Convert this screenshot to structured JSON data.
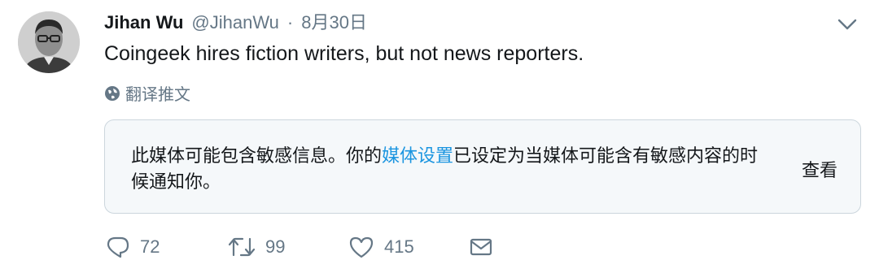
{
  "tweet": {
    "author_name": "Jihan Wu",
    "handle": "@JihanWu",
    "separator": "·",
    "date": "8月30日",
    "text": "Coingeek hires fiction writers, but not news reporters.",
    "translate_label": "翻译推文"
  },
  "media_warning": {
    "text_before": "此媒体可能包含敏感信息。你的",
    "link_text": "媒体设置",
    "text_after": "已设定为当媒体可能含有敏感内容的时候通知你。",
    "view_label": "查看"
  },
  "actions": {
    "reply_count": "72",
    "retweet_count": "99",
    "like_count": "415"
  },
  "colors": {
    "link": "#1b95e0",
    "muted": "#657786",
    "warning_background": "#f5f8fa"
  },
  "icons": [
    "avatar",
    "chevron-down-icon",
    "globe-icon",
    "reply-icon",
    "retweet-icon",
    "like-icon",
    "message-icon"
  ]
}
